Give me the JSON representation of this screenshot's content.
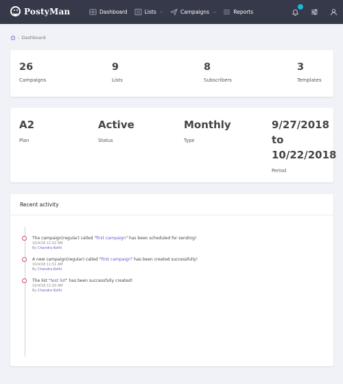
{
  "brand": {
    "name": "PostyMan"
  },
  "nav": {
    "items": [
      {
        "label": "Dashboard",
        "icon": "dashboard-icon",
        "has_dropdown": false
      },
      {
        "label": "Lists",
        "icon": "list-icon",
        "has_dropdown": true
      },
      {
        "label": "Campaigns",
        "icon": "paper-plane-icon",
        "has_dropdown": true
      },
      {
        "label": "Reports",
        "icon": "reports-icon",
        "has_dropdown": false
      }
    ],
    "chevron": "⌵"
  },
  "breadcrumb": {
    "current": "Dashboard",
    "separator": "-"
  },
  "stats": [
    {
      "value": "26",
      "label": "Campaigns"
    },
    {
      "value": "9",
      "label": "Lists"
    },
    {
      "value": "8",
      "label": "Subscribers"
    },
    {
      "value": "3",
      "label": "Templates"
    }
  ],
  "plan": {
    "plan": {
      "value": "A2",
      "label": "Plan"
    },
    "status": {
      "value": "Active",
      "label": "Status"
    },
    "type": {
      "value": "Monthly",
      "label": "Type"
    },
    "period": {
      "start": "9/27/2018",
      "to": "to",
      "end": "10/22/2018",
      "label": "Period"
    }
  },
  "activity": {
    "title": "Recent activity",
    "items": [
      {
        "prefix": "The campaign(regular) called \"",
        "link": "first campaign",
        "suffix": "\" has been scheduled for sending!",
        "time": "10/4/18 11:52 AM",
        "by_label": "By ",
        "author": "Chandra Kothi"
      },
      {
        "prefix": "A new campaign(regular) called \"",
        "link": "first campaign",
        "suffix": "\" has been created successfully!",
        "time": "10/4/18 11:51 AM",
        "by_label": "By ",
        "author": "Chandra Kothi"
      },
      {
        "prefix": "The list \"",
        "link": "test list",
        "suffix": "\" has been successfully created!",
        "time": "10/4/18 11:50 AM",
        "by_label": "By ",
        "author": "Chandra Kothi"
      }
    ]
  },
  "colors": {
    "topbar": "#363949",
    "accent": "#6a5acd",
    "notification": "#17b8d6",
    "timeline_dot": "#c94b5f"
  }
}
